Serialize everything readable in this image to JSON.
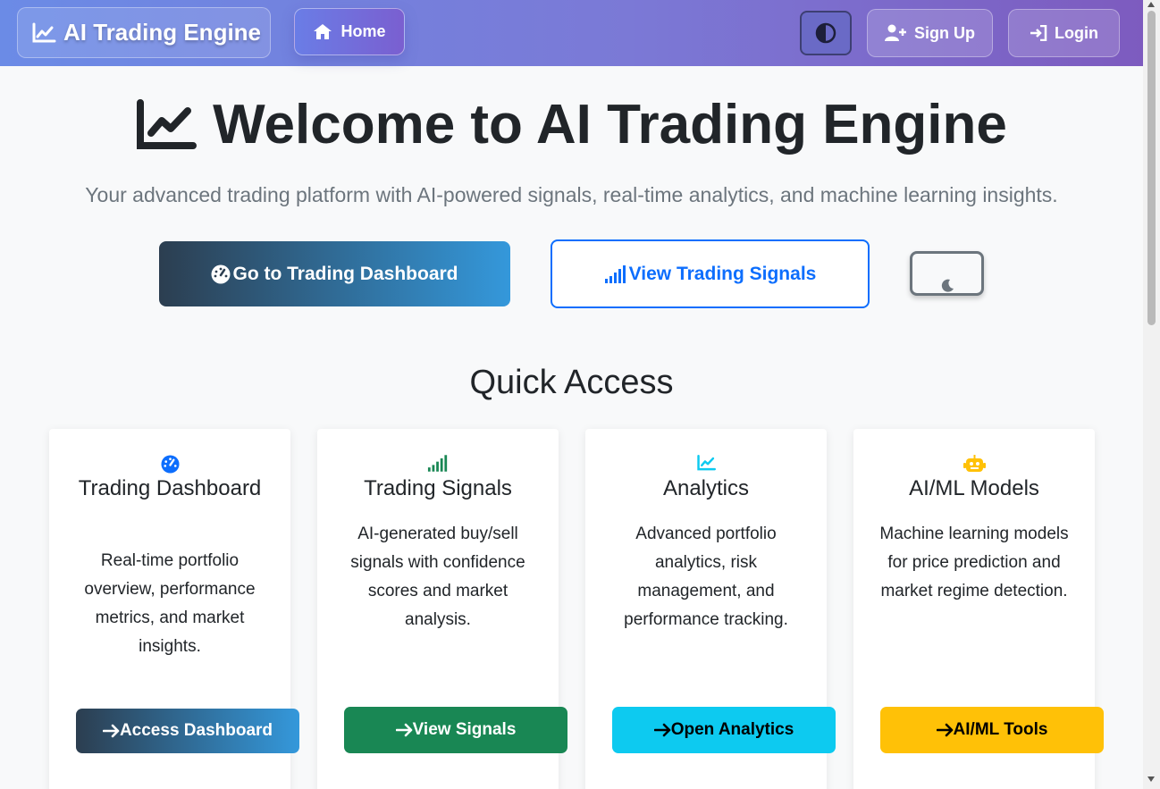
{
  "navbar": {
    "brand": "AI Trading Engine",
    "home_label": "Home",
    "signup_label": "Sign Up",
    "login_label": "Login",
    "icons": [
      "chart-line-icon",
      "home-icon",
      "contrast-icon",
      "user-plus-icon",
      "login-icon"
    ]
  },
  "hero": {
    "title": "Welcome to AI Trading Engine",
    "subtitle": "Your advanced trading platform with AI-powered signals, real-time analytics, and machine learning insights.",
    "dashboard_button": "Go to Trading Dashboard",
    "signals_button": "View Trading Signals"
  },
  "quick_access": {
    "title": "Quick Access",
    "cards": [
      {
        "icon": "dashboard-gauge-icon",
        "title": "Trading Dashboard",
        "text": "Real-time portfolio overview, performance metrics, and market insights.",
        "button": "Access Dashboard"
      },
      {
        "icon": "signal-bars-icon",
        "title": "Trading Signals",
        "text": "AI-generated buy/sell signals with confidence scores and market analysis.",
        "button": "View Signals"
      },
      {
        "icon": "chart-line-icon",
        "title": "Analytics",
        "text": "Advanced portfolio analytics, risk management, and performance tracking.",
        "button": "Open Analytics"
      },
      {
        "icon": "robot-icon",
        "title": "AI/ML Models",
        "text": "Machine learning models for price prediction and market regime detection.",
        "button": "AI/ML Tools"
      }
    ]
  },
  "colors": {
    "primary": "#0d6efd",
    "success": "#198754",
    "info": "#0dcaf0",
    "warning": "#ffc107",
    "dark_gradient_start": "#2c3e50",
    "dark_gradient_end": "#3498db"
  }
}
